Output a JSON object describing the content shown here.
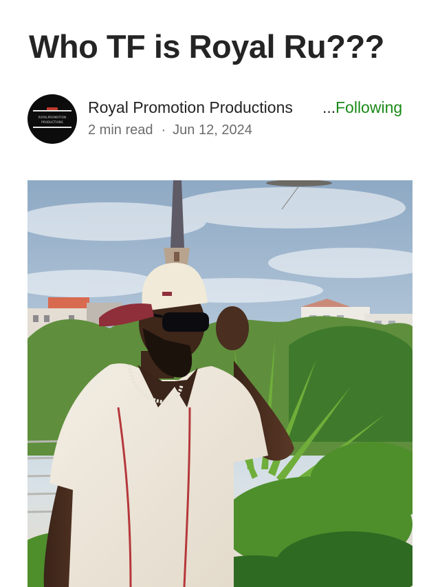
{
  "article": {
    "title": "Who TF is Royal Ru???"
  },
  "author": {
    "name": "Royal Promotion Productions",
    "truncation": "...",
    "follow_status": "Following",
    "avatar": {
      "icon": "publication-logo",
      "line1": "ROYALPROMOTION",
      "line2": "PRODUCTIONS"
    }
  },
  "meta": {
    "read_time": "2  min read",
    "separator": "·",
    "date": "Jun 12, 2024"
  },
  "colors": {
    "text": "#242424",
    "muted": "#6b6b6b",
    "accent_green": "#1a8917"
  }
}
